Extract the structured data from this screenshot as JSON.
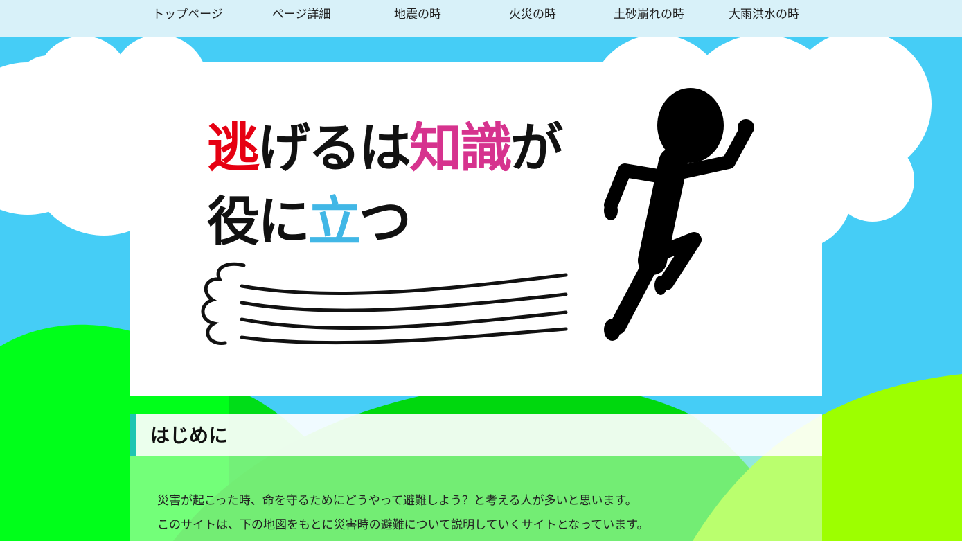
{
  "nav": {
    "items": [
      "トップページ",
      "ページ詳細",
      "地震の時",
      "火災の時",
      "土砂崩れの時",
      "大雨洪水の時"
    ]
  },
  "hero": {
    "line1_part1": "逃",
    "line1_part2": "げるは",
    "line1_part3": "知識",
    "line1_part4": "が",
    "line2_part1": "役に",
    "line2_part2": "立",
    "line2_part3": "つ"
  },
  "intro": {
    "heading": "はじめに",
    "paragraph1": "災害が起こった時、命を守るためにどうやって避難しよう？と考える人が多いと思います。",
    "paragraph2": "このサイトは、下の地図をもとに災害時の避難について説明していくサイトとなっています。"
  },
  "colors": {
    "sky": "#45cdf6",
    "nav_bg": "#d8f1f9",
    "hill_green": "#00ff1a",
    "hill_lime": "#a0ff00",
    "accent_teal": "#1ec6b2",
    "title_red": "#e60012",
    "title_pink": "#d6338e",
    "title_blue": "#41b7e6"
  }
}
